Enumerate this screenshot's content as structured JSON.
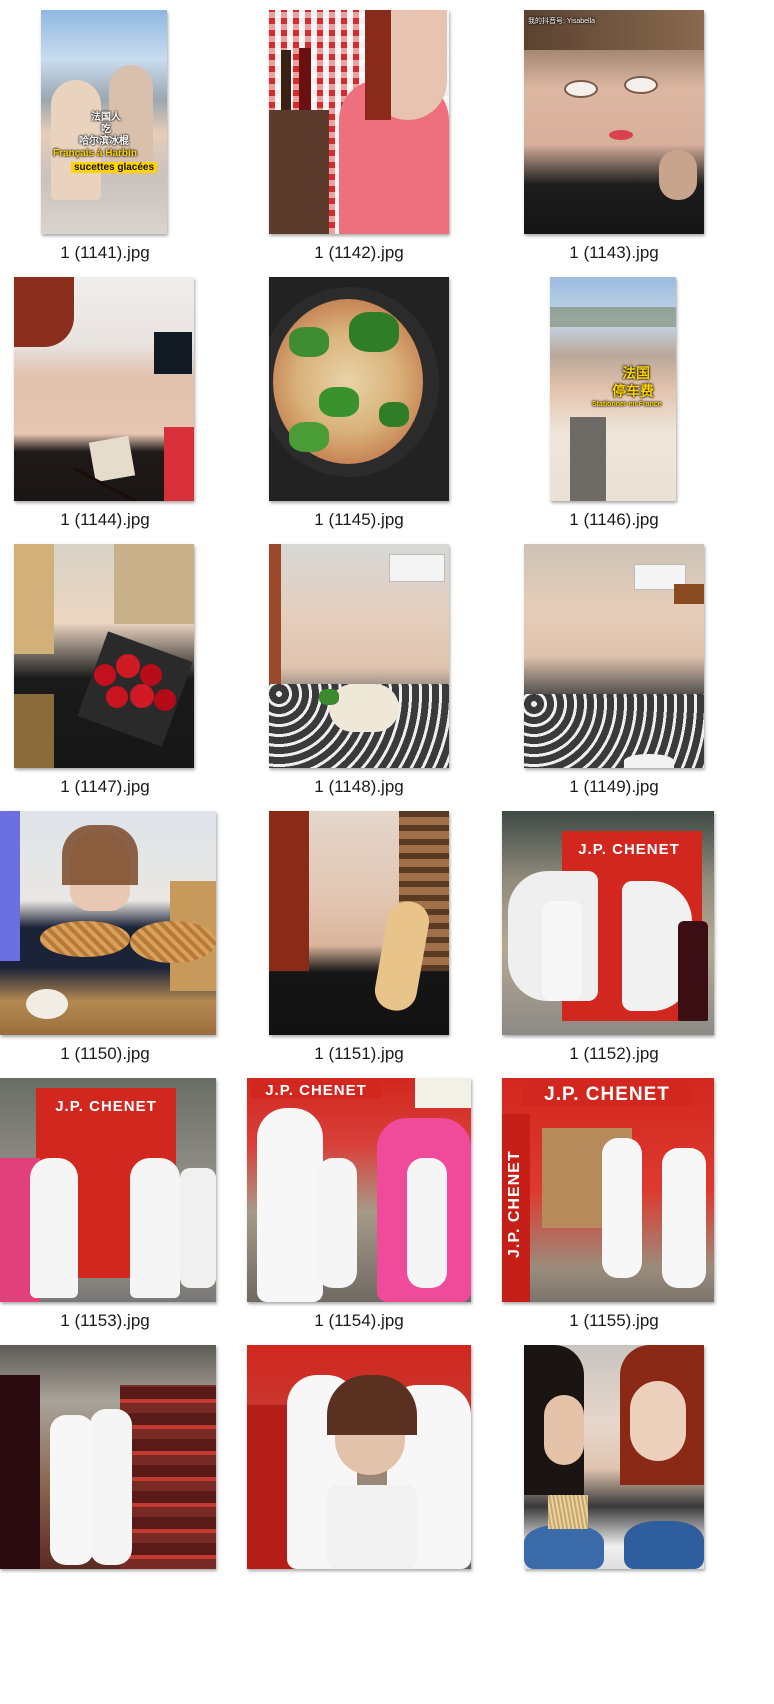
{
  "files": [
    {
      "name": "1 (1141).jpg",
      "overlay": [
        "法国人",
        "吃",
        "哈尔滨冰棍",
        "Français à Harbin",
        "sucettes glacées"
      ]
    },
    {
      "name": "1 (1142).jpg"
    },
    {
      "name": "1 (1143).jpg",
      "overlay": [
        "我的抖音号: Yisabella"
      ]
    },
    {
      "name": "1 (1144).jpg"
    },
    {
      "name": "1 (1145).jpg"
    },
    {
      "name": "1 (1146).jpg",
      "overlay": [
        "法国",
        "停车费",
        "Stationner en France"
      ]
    },
    {
      "name": "1 (1147).jpg"
    },
    {
      "name": "1 (1148).jpg"
    },
    {
      "name": "1 (1149).jpg"
    },
    {
      "name": "1 (1150).jpg"
    },
    {
      "name": "1 (1151).jpg"
    },
    {
      "name": "1 (1152).jpg",
      "overlay": [
        "J.P. CHENET"
      ]
    },
    {
      "name": "1 (1153).jpg",
      "overlay": [
        "J.P. CHENET"
      ]
    },
    {
      "name": "1 (1154).jpg",
      "overlay": [
        "J.P. CHENET"
      ]
    },
    {
      "name": "1 (1155).jpg",
      "overlay": [
        "J.P. CHENET",
        "J.P. CHENET"
      ]
    },
    {
      "name": "",
      "overlay": []
    },
    {
      "name": ""
    },
    {
      "name": ""
    }
  ]
}
